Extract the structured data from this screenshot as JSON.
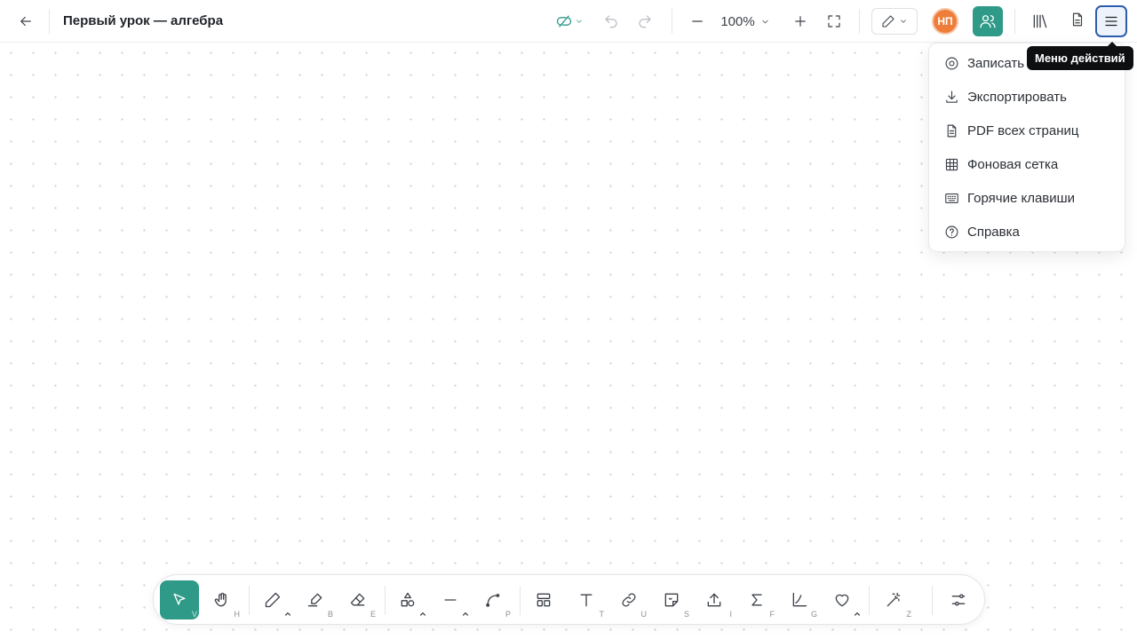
{
  "header": {
    "title": "Первый урок — алгебра",
    "zoom": "100%",
    "avatar_initials": "НП"
  },
  "menu": {
    "tooltip": "Меню действий",
    "items": [
      {
        "label": "Записать",
        "icon": "record-icon"
      },
      {
        "label": "Экспортировать",
        "icon": "download-icon"
      },
      {
        "label": "PDF всех страниц",
        "icon": "file-icon"
      },
      {
        "label": "Фоновая сетка",
        "icon": "grid-icon"
      },
      {
        "label": "Горячие клавиши",
        "icon": "keyboard-icon"
      },
      {
        "label": "Справка",
        "icon": "help-icon"
      }
    ]
  },
  "toolbar": {
    "tools": [
      {
        "name": "select",
        "key": "V",
        "icon": "cursor-icon",
        "active": true
      },
      {
        "name": "hand",
        "key": "H",
        "icon": "hand-icon"
      },
      {
        "name": "pen",
        "key": "",
        "icon": "pen-icon",
        "has_menu": true
      },
      {
        "name": "highlighter",
        "key": "B",
        "icon": "highlighter-icon"
      },
      {
        "name": "eraser",
        "key": "E",
        "icon": "eraser-icon"
      },
      {
        "name": "shapes",
        "key": "",
        "icon": "shapes-icon",
        "has_menu": true
      },
      {
        "name": "line",
        "key": "",
        "icon": "line-icon",
        "has_menu": true
      },
      {
        "name": "curve",
        "key": "P",
        "icon": "curve-icon"
      },
      {
        "name": "templates",
        "key": "",
        "icon": "layout-icon"
      },
      {
        "name": "text",
        "key": "T",
        "icon": "text-icon"
      },
      {
        "name": "link",
        "key": "U",
        "icon": "link-icon"
      },
      {
        "name": "sticker",
        "key": "S",
        "icon": "sticker-icon"
      },
      {
        "name": "upload",
        "key": "I",
        "icon": "upload-icon"
      },
      {
        "name": "formula",
        "key": "F",
        "icon": "sigma-icon"
      },
      {
        "name": "graph",
        "key": "G",
        "icon": "graph-icon"
      },
      {
        "name": "favorite",
        "key": "",
        "icon": "heart-icon",
        "has_menu": true
      },
      {
        "name": "magic",
        "key": "Z",
        "icon": "magic-wand-icon"
      },
      {
        "name": "settings",
        "key": "",
        "icon": "sliders-icon"
      }
    ]
  },
  "colors": {
    "accent": "#2f9a88",
    "avatar": "#ef7d3a",
    "menu_focus": "#2a5db0"
  }
}
